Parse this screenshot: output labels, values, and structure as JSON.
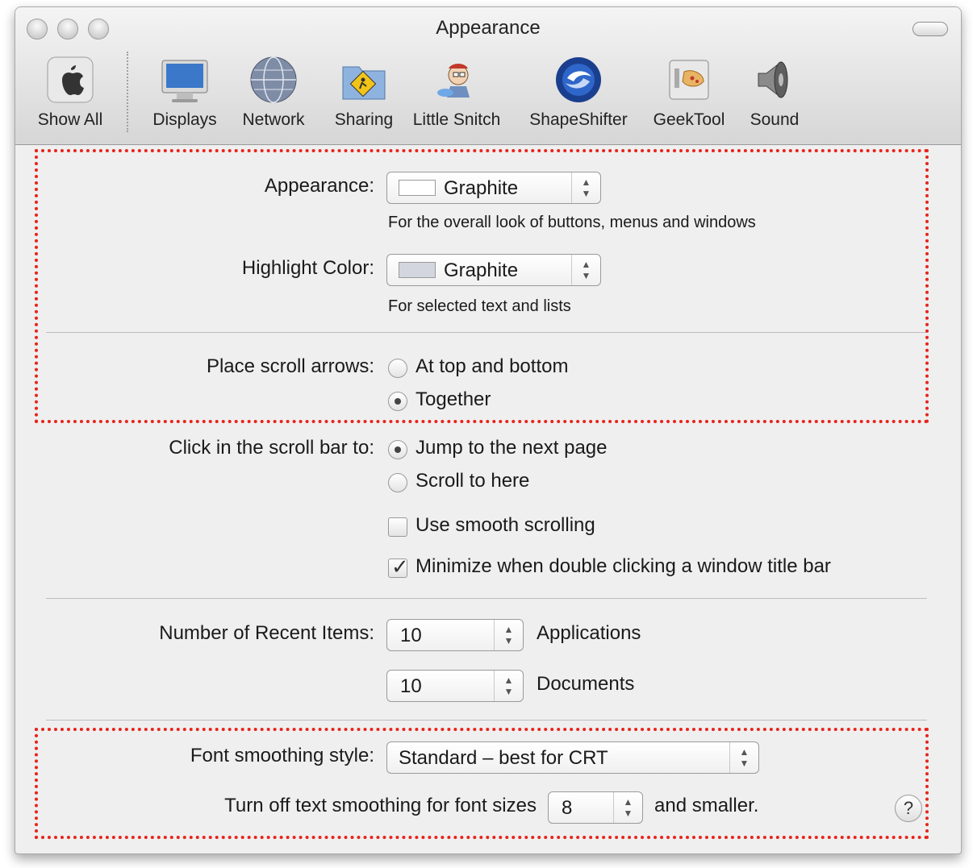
{
  "window": {
    "title": "Appearance"
  },
  "toolbar": {
    "items": [
      {
        "label": "Show All",
        "icon": "apple-icon"
      },
      {
        "label": "Displays",
        "icon": "display-icon"
      },
      {
        "label": "Network",
        "icon": "network-globe-icon"
      },
      {
        "label": "Sharing",
        "icon": "sharing-folder-icon"
      },
      {
        "label": "Little Snitch",
        "icon": "little-snitch-icon"
      },
      {
        "label": "ShapeShifter",
        "icon": "shapeshifter-icon"
      },
      {
        "label": "GeekTool",
        "icon": "geektool-icon"
      },
      {
        "label": "Sound",
        "icon": "speaker-icon"
      }
    ]
  },
  "appearance": {
    "label": "Appearance:",
    "value": "Graphite",
    "hint": "For the overall look of buttons, menus and windows"
  },
  "highlight": {
    "label": "Highlight Color:",
    "value": "Graphite",
    "swatch_color": "#d3d6de",
    "hint": "For selected text and lists"
  },
  "scroll_arrows": {
    "label": "Place scroll arrows:",
    "options": [
      "At top and bottom",
      "Together"
    ],
    "selected": "Together"
  },
  "scroll_click": {
    "label": "Click in the scroll bar to:",
    "options": [
      "Jump to the next page",
      "Scroll to here"
    ],
    "selected": "Jump to the next page"
  },
  "checkboxes": {
    "smooth_scrolling": {
      "label": "Use smooth scrolling",
      "checked": false
    },
    "minimize_double_click": {
      "label": "Minimize when double clicking a window title bar",
      "checked": true
    }
  },
  "recent": {
    "label": "Number of Recent Items:",
    "applications_value": "10",
    "applications_label": "Applications",
    "documents_value": "10",
    "documents_label": "Documents"
  },
  "font_smoothing": {
    "label": "Font smoothing style:",
    "value": "Standard – best for CRT",
    "turn_off_label": "Turn off text smoothing for font sizes",
    "size_value": "8",
    "suffix": "and smaller."
  },
  "help": {
    "label": "?"
  },
  "colors": {
    "highlight_box": "#e8231a"
  }
}
